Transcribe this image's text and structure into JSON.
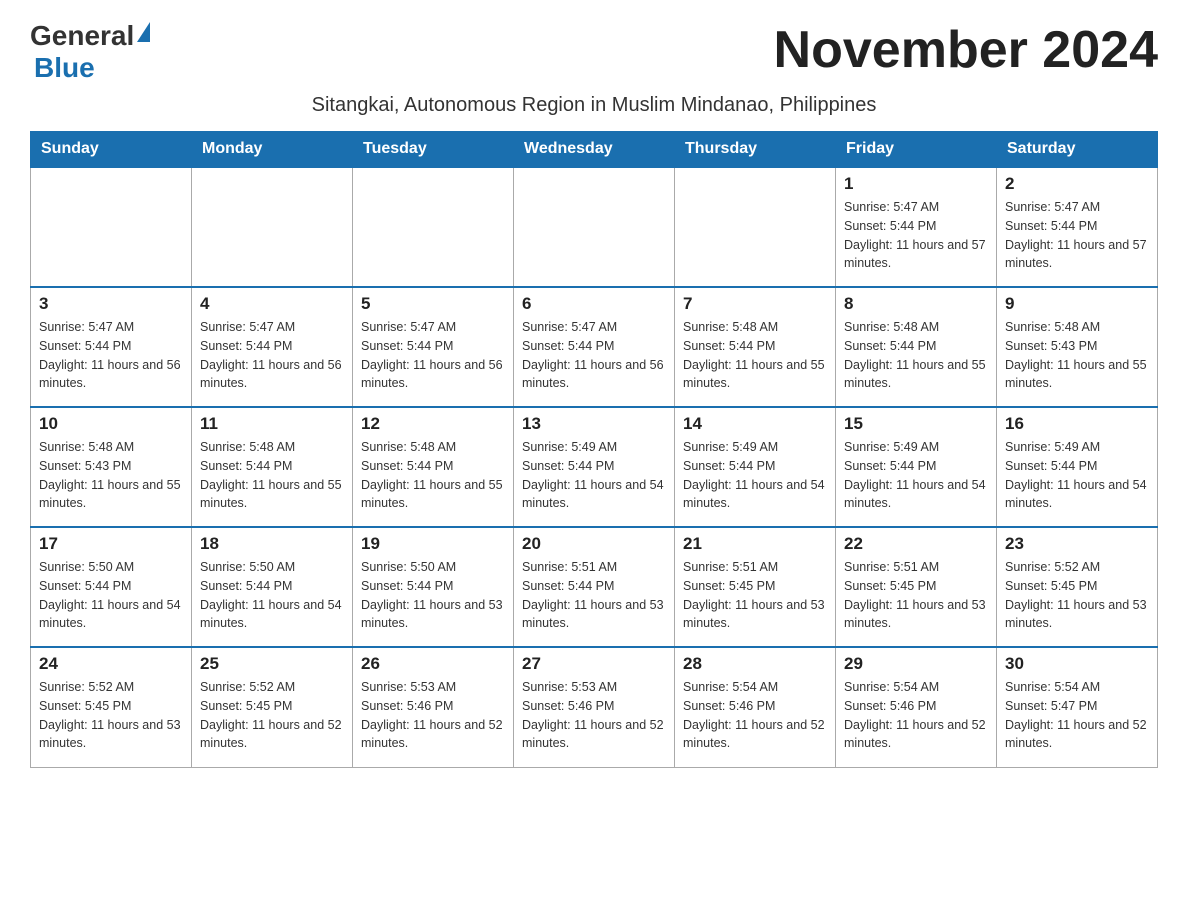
{
  "header": {
    "logo_general": "General",
    "logo_blue": "Blue",
    "month_title": "November 2024",
    "subtitle": "Sitangkai, Autonomous Region in Muslim Mindanao, Philippines"
  },
  "days_of_week": [
    "Sunday",
    "Monday",
    "Tuesday",
    "Wednesday",
    "Thursday",
    "Friday",
    "Saturday"
  ],
  "weeks": [
    {
      "days": [
        {
          "number": "",
          "sunrise": "",
          "sunset": "",
          "daylight": ""
        },
        {
          "number": "",
          "sunrise": "",
          "sunset": "",
          "daylight": ""
        },
        {
          "number": "",
          "sunrise": "",
          "sunset": "",
          "daylight": ""
        },
        {
          "number": "",
          "sunrise": "",
          "sunset": "",
          "daylight": ""
        },
        {
          "number": "",
          "sunrise": "",
          "sunset": "",
          "daylight": ""
        },
        {
          "number": "1",
          "sunrise": "Sunrise: 5:47 AM",
          "sunset": "Sunset: 5:44 PM",
          "daylight": "Daylight: 11 hours and 57 minutes."
        },
        {
          "number": "2",
          "sunrise": "Sunrise: 5:47 AM",
          "sunset": "Sunset: 5:44 PM",
          "daylight": "Daylight: 11 hours and 57 minutes."
        }
      ]
    },
    {
      "days": [
        {
          "number": "3",
          "sunrise": "Sunrise: 5:47 AM",
          "sunset": "Sunset: 5:44 PM",
          "daylight": "Daylight: 11 hours and 56 minutes."
        },
        {
          "number": "4",
          "sunrise": "Sunrise: 5:47 AM",
          "sunset": "Sunset: 5:44 PM",
          "daylight": "Daylight: 11 hours and 56 minutes."
        },
        {
          "number": "5",
          "sunrise": "Sunrise: 5:47 AM",
          "sunset": "Sunset: 5:44 PM",
          "daylight": "Daylight: 11 hours and 56 minutes."
        },
        {
          "number": "6",
          "sunrise": "Sunrise: 5:47 AM",
          "sunset": "Sunset: 5:44 PM",
          "daylight": "Daylight: 11 hours and 56 minutes."
        },
        {
          "number": "7",
          "sunrise": "Sunrise: 5:48 AM",
          "sunset": "Sunset: 5:44 PM",
          "daylight": "Daylight: 11 hours and 55 minutes."
        },
        {
          "number": "8",
          "sunrise": "Sunrise: 5:48 AM",
          "sunset": "Sunset: 5:44 PM",
          "daylight": "Daylight: 11 hours and 55 minutes."
        },
        {
          "number": "9",
          "sunrise": "Sunrise: 5:48 AM",
          "sunset": "Sunset: 5:43 PM",
          "daylight": "Daylight: 11 hours and 55 minutes."
        }
      ]
    },
    {
      "days": [
        {
          "number": "10",
          "sunrise": "Sunrise: 5:48 AM",
          "sunset": "Sunset: 5:43 PM",
          "daylight": "Daylight: 11 hours and 55 minutes."
        },
        {
          "number": "11",
          "sunrise": "Sunrise: 5:48 AM",
          "sunset": "Sunset: 5:44 PM",
          "daylight": "Daylight: 11 hours and 55 minutes."
        },
        {
          "number": "12",
          "sunrise": "Sunrise: 5:48 AM",
          "sunset": "Sunset: 5:44 PM",
          "daylight": "Daylight: 11 hours and 55 minutes."
        },
        {
          "number": "13",
          "sunrise": "Sunrise: 5:49 AM",
          "sunset": "Sunset: 5:44 PM",
          "daylight": "Daylight: 11 hours and 54 minutes."
        },
        {
          "number": "14",
          "sunrise": "Sunrise: 5:49 AM",
          "sunset": "Sunset: 5:44 PM",
          "daylight": "Daylight: 11 hours and 54 minutes."
        },
        {
          "number": "15",
          "sunrise": "Sunrise: 5:49 AM",
          "sunset": "Sunset: 5:44 PM",
          "daylight": "Daylight: 11 hours and 54 minutes."
        },
        {
          "number": "16",
          "sunrise": "Sunrise: 5:49 AM",
          "sunset": "Sunset: 5:44 PM",
          "daylight": "Daylight: 11 hours and 54 minutes."
        }
      ]
    },
    {
      "days": [
        {
          "number": "17",
          "sunrise": "Sunrise: 5:50 AM",
          "sunset": "Sunset: 5:44 PM",
          "daylight": "Daylight: 11 hours and 54 minutes."
        },
        {
          "number": "18",
          "sunrise": "Sunrise: 5:50 AM",
          "sunset": "Sunset: 5:44 PM",
          "daylight": "Daylight: 11 hours and 54 minutes."
        },
        {
          "number": "19",
          "sunrise": "Sunrise: 5:50 AM",
          "sunset": "Sunset: 5:44 PM",
          "daylight": "Daylight: 11 hours and 53 minutes."
        },
        {
          "number": "20",
          "sunrise": "Sunrise: 5:51 AM",
          "sunset": "Sunset: 5:44 PM",
          "daylight": "Daylight: 11 hours and 53 minutes."
        },
        {
          "number": "21",
          "sunrise": "Sunrise: 5:51 AM",
          "sunset": "Sunset: 5:45 PM",
          "daylight": "Daylight: 11 hours and 53 minutes."
        },
        {
          "number": "22",
          "sunrise": "Sunrise: 5:51 AM",
          "sunset": "Sunset: 5:45 PM",
          "daylight": "Daylight: 11 hours and 53 minutes."
        },
        {
          "number": "23",
          "sunrise": "Sunrise: 5:52 AM",
          "sunset": "Sunset: 5:45 PM",
          "daylight": "Daylight: 11 hours and 53 minutes."
        }
      ]
    },
    {
      "days": [
        {
          "number": "24",
          "sunrise": "Sunrise: 5:52 AM",
          "sunset": "Sunset: 5:45 PM",
          "daylight": "Daylight: 11 hours and 53 minutes."
        },
        {
          "number": "25",
          "sunrise": "Sunrise: 5:52 AM",
          "sunset": "Sunset: 5:45 PM",
          "daylight": "Daylight: 11 hours and 52 minutes."
        },
        {
          "number": "26",
          "sunrise": "Sunrise: 5:53 AM",
          "sunset": "Sunset: 5:46 PM",
          "daylight": "Daylight: 11 hours and 52 minutes."
        },
        {
          "number": "27",
          "sunrise": "Sunrise: 5:53 AM",
          "sunset": "Sunset: 5:46 PM",
          "daylight": "Daylight: 11 hours and 52 minutes."
        },
        {
          "number": "28",
          "sunrise": "Sunrise: 5:54 AM",
          "sunset": "Sunset: 5:46 PM",
          "daylight": "Daylight: 11 hours and 52 minutes."
        },
        {
          "number": "29",
          "sunrise": "Sunrise: 5:54 AM",
          "sunset": "Sunset: 5:46 PM",
          "daylight": "Daylight: 11 hours and 52 minutes."
        },
        {
          "number": "30",
          "sunrise": "Sunrise: 5:54 AM",
          "sunset": "Sunset: 5:47 PM",
          "daylight": "Daylight: 11 hours and 52 minutes."
        }
      ]
    }
  ]
}
